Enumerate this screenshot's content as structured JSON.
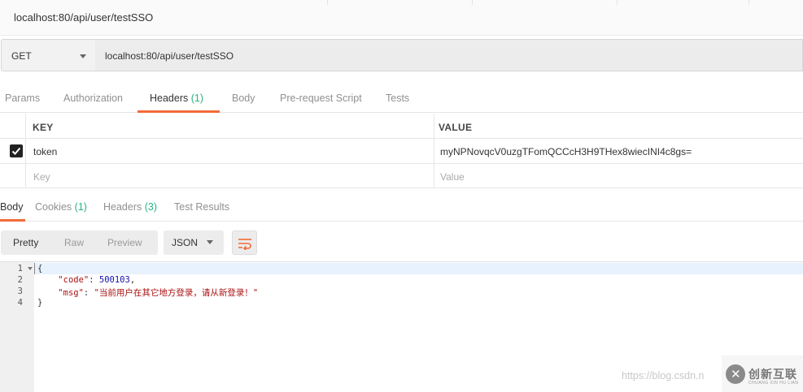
{
  "tab": {
    "title": "localhost:80/api/user/testSSO"
  },
  "request": {
    "method": "GET",
    "url": "localhost:80/api/user/testSSO"
  },
  "request_tabs": [
    {
      "label": "Params"
    },
    {
      "label": "Authorization"
    },
    {
      "label": "Headers",
      "count": "(1)",
      "active": true
    },
    {
      "label": "Body"
    },
    {
      "label": "Pre-request Script"
    },
    {
      "label": "Tests"
    }
  ],
  "headers_table": {
    "key_header": "KEY",
    "value_header": "VALUE",
    "rows": [
      {
        "checked": true,
        "key": "token",
        "value": "myNPNovqcV0uzgTFomQCCcH3H9THex8wiecINI4c8gs="
      }
    ],
    "placeholder_key": "Key",
    "placeholder_value": "Value"
  },
  "response_tabs": [
    {
      "label": "Body",
      "active": true
    },
    {
      "label": "Cookies",
      "count": "(1)"
    },
    {
      "label": "Headers",
      "count": "(3)"
    },
    {
      "label": "Test Results"
    }
  ],
  "toolbar": {
    "formats": [
      "Pretty",
      "Raw",
      "Preview"
    ],
    "active_format": "Pretty",
    "language": "JSON",
    "wrap_icon": "wrap-lines-icon"
  },
  "response_body": {
    "line_numbers": [
      "1",
      "2",
      "3",
      "4"
    ],
    "open_brace": "{",
    "close_brace": "}",
    "code_key": "\"code\"",
    "code_value": "500103",
    "msg_key": "\"msg\"",
    "msg_value": "\"当前用户在其它地方登录，请从新登录！\""
  },
  "watermark": {
    "url": "https://blog.csdn.n",
    "brand": "创新互联",
    "brand_sub": "CHUANG XIN HU LIAN"
  },
  "colors": {
    "accent": "#f26b3a",
    "count": "#26b47f"
  }
}
